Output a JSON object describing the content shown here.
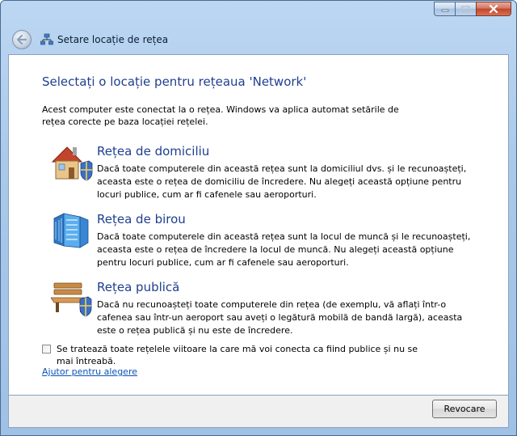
{
  "window": {
    "buttons": {
      "minimize": "minimize-icon",
      "maximize": "maximize-icon",
      "close": "close-icon"
    }
  },
  "nav": {
    "title": "Setare locație de rețea",
    "back_icon": "back-arrow-icon",
    "title_icon": "network-icon"
  },
  "content": {
    "heading": "Selectați o locație pentru rețeaua 'Network'",
    "intro": "Acest computer este conectat la o rețea. Windows va aplica automat setările de rețea corecte pe baza locației rețelei.",
    "options": [
      {
        "icon": "home-network-icon",
        "title": "Rețea de domiciliu",
        "description": "Dacă toate computerele din această rețea sunt la domiciliul dvs. și le recunoașteți, aceasta este o rețea de domiciliu de încredere. Nu alegeți această opțiune pentru locuri publice, cum ar fi cafenele sau aeroporturi."
      },
      {
        "icon": "work-network-icon",
        "title": "Rețea de birou",
        "description": "Dacă toate computerele din această rețea sunt la locul de muncă și le recunoașteți, aceasta este o rețea de încredere la locul de muncă. Nu alegeți această opțiune pentru locuri publice, cum ar fi cafenele sau aeroporturi."
      },
      {
        "icon": "public-network-icon",
        "title": "Rețea publică",
        "description": "Dacă nu recunoașteți toate computerele din rețea (de exemplu, vă aflați într-o cafenea sau într-un aeroport sau aveți o legătură mobilă de bandă largă), aceasta este o rețea publică și nu este de încredere."
      }
    ],
    "checkbox_label": "Se tratează toate rețelele viitoare la care mă voi conecta ca fiind publice și nu se mai întreabă.",
    "checkbox_checked": false,
    "help_link": "Ajutor pentru alegere"
  },
  "footer": {
    "cancel_label": "Revocare"
  },
  "colors": {
    "heading": "#1e3f8f",
    "link": "#0b53b4",
    "frame": "#a9c8ea"
  }
}
